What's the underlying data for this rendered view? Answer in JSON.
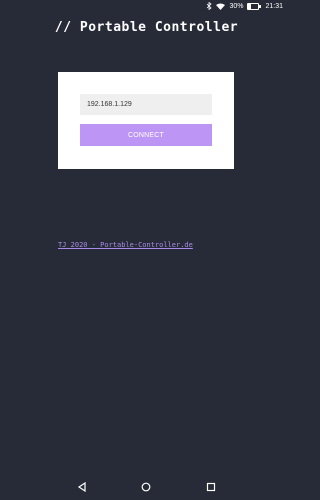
{
  "status_bar": {
    "bluetooth_icon": "bluetooth-icon",
    "wifi_icon": "wifi-icon",
    "battery_percent": "30%",
    "battery_level": 0.3,
    "time": "21:31"
  },
  "header": {
    "title": "// Portable Controller"
  },
  "connect_card": {
    "ip_value": "192.168.1.129",
    "connect_label": "CONNECT",
    "button_color": "#bd96f5"
  },
  "footer": {
    "link_text": "TJ 2020 - Portable-Controller.de"
  },
  "nav_bar": {
    "back_icon": "back-icon",
    "home_icon": "home-icon",
    "recents_icon": "recents-icon"
  },
  "colors": {
    "background": "#272a37",
    "accent": "#bd96f5",
    "link": "#a88be6"
  }
}
